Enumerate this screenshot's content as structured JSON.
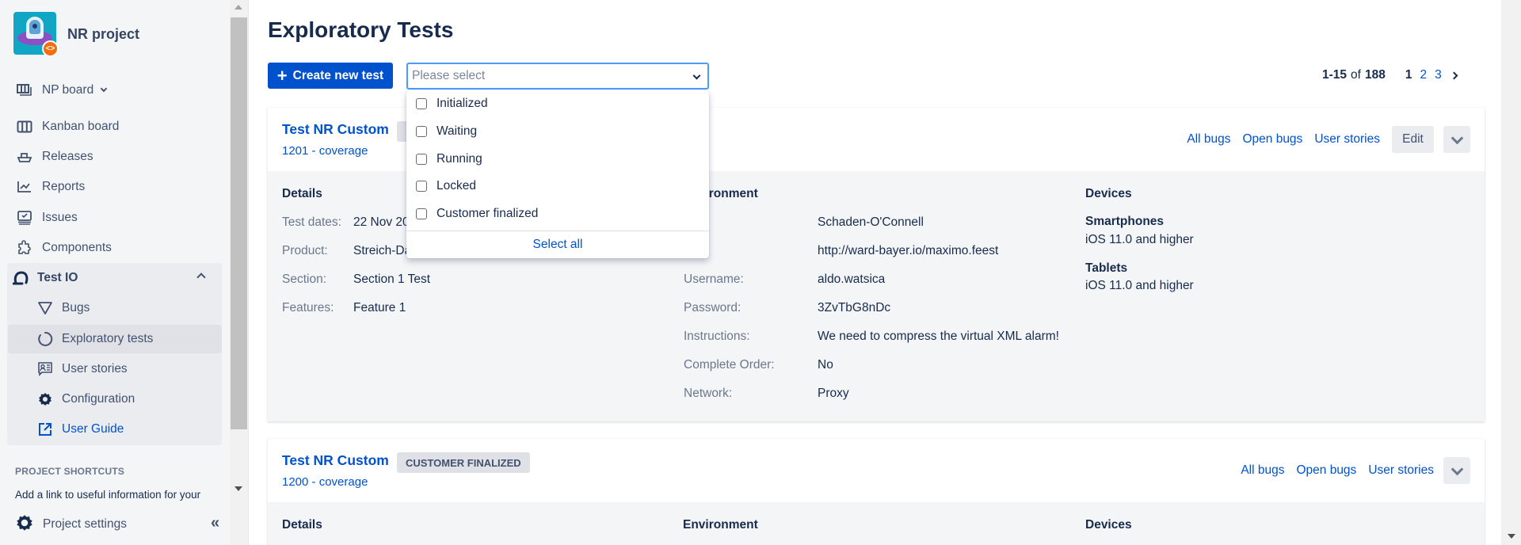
{
  "sidebar": {
    "project_name": "NR project",
    "project_badge": "<>",
    "board_selector": "NP board",
    "items": [
      {
        "label": "Kanban board",
        "icon": "kanban-board-icon"
      },
      {
        "label": "Releases",
        "icon": "ship-icon"
      },
      {
        "label": "Reports",
        "icon": "chart-line-icon"
      },
      {
        "label": "Issues",
        "icon": "issues-icon"
      },
      {
        "label": "Components",
        "icon": "puzzle-icon"
      }
    ],
    "group": {
      "label": "Test IO",
      "icon": "testio-logo-icon",
      "items": [
        {
          "label": "Bugs",
          "icon": "triangle-down-icon"
        },
        {
          "label": "Exploratory tests",
          "icon": "circle-icon",
          "active": true
        },
        {
          "label": "User stories",
          "icon": "user-card-icon"
        },
        {
          "label": "Configuration",
          "icon": "gear-icon"
        },
        {
          "label": "User Guide",
          "icon": "external-link-icon",
          "link": true
        }
      ]
    },
    "shortcuts_heading": "PROJECT SHORTCUTS",
    "shortcuts_text": "Add a link to useful information for your",
    "project_settings": "Project settings",
    "collapse_label": "«"
  },
  "main": {
    "title": "Exploratory Tests",
    "create_button": "Create new test",
    "create_button_icon": "+",
    "status_filter": {
      "placeholder": "Please select",
      "options": [
        "Initialized",
        "Waiting",
        "Running",
        "Locked",
        "Customer finalized"
      ],
      "select_all": "Select all"
    },
    "pagination": {
      "range": "1-15",
      "of_label": "of",
      "total": "188",
      "current_page": "1",
      "pages": [
        "2",
        "3"
      ]
    },
    "cards": [
      {
        "title": "Test NR Custom",
        "badge": "",
        "subtitle": "1201 - coverage",
        "actions": [
          "All bugs",
          "Open bugs",
          "User stories"
        ],
        "edit_label": "Edit",
        "details_heading": "Details",
        "details": [
          {
            "label": "Test dates:",
            "value": "22 Nov 20"
          },
          {
            "label": "Product:",
            "value": "Streich-Da"
          },
          {
            "label": "Section:",
            "value": "Section 1 Test"
          },
          {
            "label": "Features:",
            "value": "Feature 1"
          }
        ],
        "environment_heading": "Environment",
        "environment_heading_visible": "ronment",
        "environment": [
          {
            "label": "",
            "value": "Schaden-O'Connell"
          },
          {
            "label": "",
            "value": "http://ward-bayer.io/maximo.feest"
          },
          {
            "label": "Username:",
            "value": "aldo.watsica"
          },
          {
            "label": "Password:",
            "value": "3ZvTbG8nDc"
          },
          {
            "label": "Instructions:",
            "value": "We need to compress the virtual XML alarm!"
          },
          {
            "label": "Complete Order:",
            "value": "No"
          },
          {
            "label": "Network:",
            "value": "Proxy"
          }
        ],
        "devices_heading": "Devices",
        "devices": [
          {
            "type": "Smartphones",
            "os": "iOS 11.0 and higher"
          },
          {
            "type": "Tablets",
            "os": "iOS 11.0 and higher"
          }
        ]
      },
      {
        "title": "Test NR Custom",
        "badge": "CUSTOMER FINALIZED",
        "subtitle": "1200 - coverage",
        "actions": [
          "All bugs",
          "Open bugs",
          "User stories"
        ],
        "details_heading": "Details",
        "environment_heading": "Environment",
        "devices_heading": "Devices"
      }
    ]
  },
  "colors": {
    "primary": "#0052cc",
    "sidebar_bg": "#f4f5f7",
    "focus_border": "#4c9aff",
    "text": "#172b4d",
    "muted": "#6b778c",
    "badge_bg": "#dfe1e6"
  }
}
